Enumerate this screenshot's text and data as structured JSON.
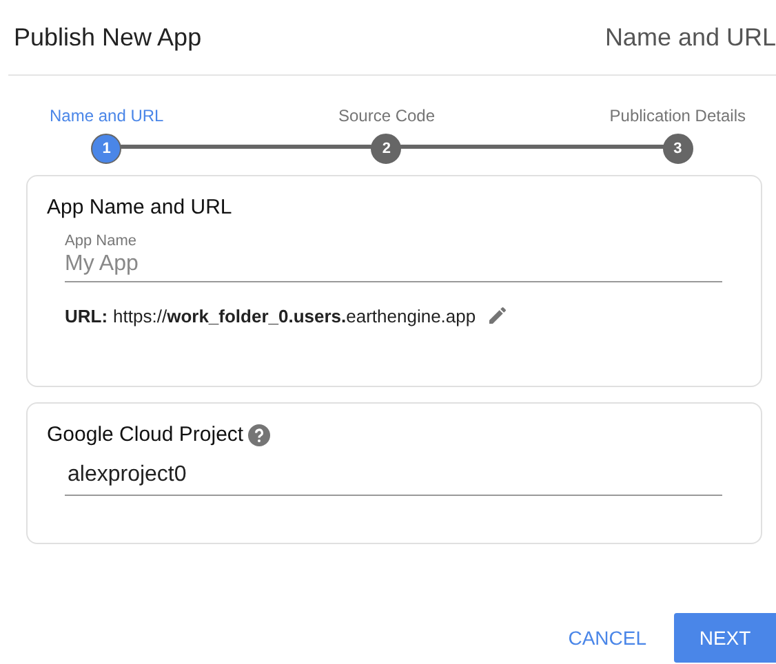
{
  "dialog": {
    "title": "Publish New App",
    "step_title": "Name and URL"
  },
  "steps": [
    {
      "label": "Name and URL",
      "number": "1",
      "selected": true
    },
    {
      "label": "Source Code",
      "number": "2",
      "selected": false
    },
    {
      "label": "Publication Details",
      "number": "3",
      "selected": false
    }
  ],
  "app_card": {
    "heading": "App Name and URL",
    "field_label": "App Name",
    "placeholder": "My App",
    "url_label": "URL:",
    "url": "https://**work_folder_0.users.**earthengine.app"
  },
  "project_card": {
    "heading": "Google Cloud Project",
    "value": "alexproject0"
  },
  "buttons": [
    {
      "label": "CANCEL",
      "kind": "flat"
    },
    {
      "label": "NEXT",
      "kind": "raised"
    }
  ]
}
